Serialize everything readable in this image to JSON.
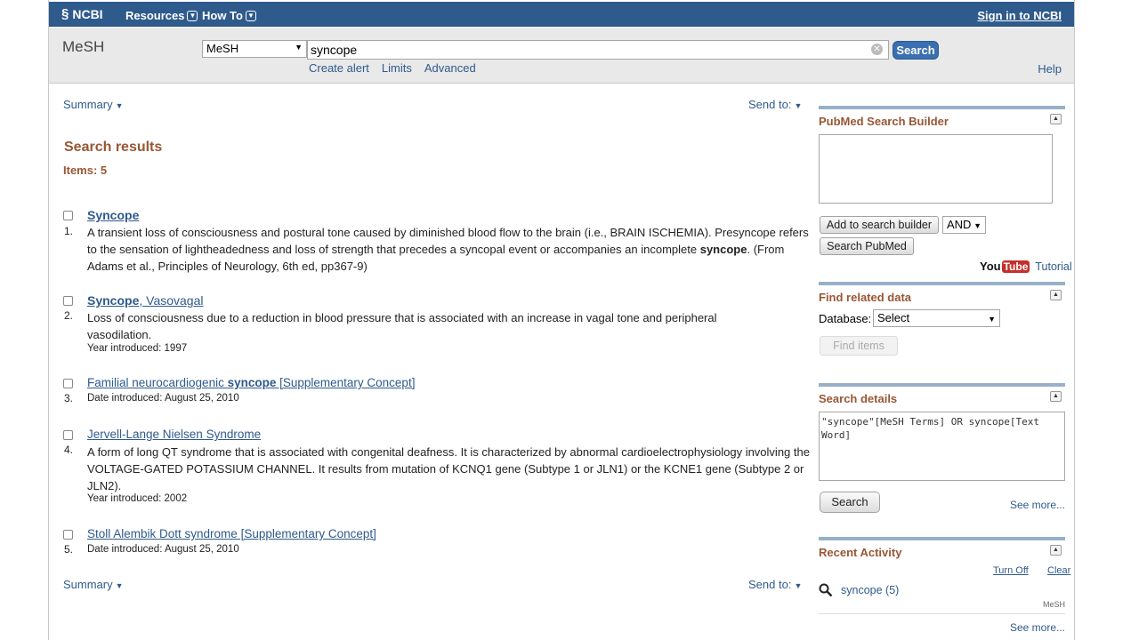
{
  "topbar": {
    "logo": "NCBI",
    "resources": "Resources",
    "howto": "How To",
    "signin": "Sign in to NCBI"
  },
  "search": {
    "db_name": "MeSH",
    "db_selected": "MeSH",
    "query": "syncope",
    "button": "Search",
    "links": [
      "Create alert",
      "Limits",
      "Advanced"
    ],
    "help": "Help"
  },
  "results": {
    "summary_label": "Summary",
    "sendto_label": "Send to:",
    "title": "Search results",
    "items_label": "Items: 5",
    "list": [
      {
        "num": "1.",
        "title_pre": "",
        "title_bold": "Syncope",
        "title_post": "",
        "desc_pre": "A transient loss of consciousness and postural tone caused by diminished blood flow to the brain (i.e., BRAIN ISCHEMIA). Presyncope refers to the sensation of lightheadedness and loss of strength that precedes a syncopal event or accompanies an incomplete ",
        "desc_bold": "syncope",
        "desc_post": ". (From Adams et al., Principles of Neurology, 6th ed, pp367-9)",
        "meta": ""
      },
      {
        "num": "2.",
        "title_pre": "",
        "title_bold": "Syncope",
        "title_post": ", Vasovagal",
        "desc_pre": "Loss of consciousness due to a reduction in blood pressure that is associated with an increase in vagal tone and peripheral vasodilation.",
        "desc_bold": "",
        "desc_post": "",
        "meta": "Year introduced: 1997"
      },
      {
        "num": "3.",
        "title_pre": "Familial neurocardiogenic ",
        "title_bold": "syncope",
        "title_post": " [Supplementary Concept]",
        "desc_pre": "",
        "desc_bold": "",
        "desc_post": "",
        "meta": "Date introduced: August 25, 2010"
      },
      {
        "num": "4.",
        "title_pre": "Jervell-Lange Nielsen Syndrome",
        "title_bold": "",
        "title_post": "",
        "desc_pre": "A form of long QT syndrome that is associated with congenital deafness. It is characterized by abnormal cardioelectrophysiology involving the VOLTAGE-GATED POTASSIUM CHANNEL. It results from mutation of KCNQ1 gene (Subtype 1 or JLN1) or the KCNE1 gene (Subtype 2 or JLN2).",
        "desc_bold": "",
        "desc_post": "",
        "meta": "Year introduced: 2002"
      },
      {
        "num": "5.",
        "title_pre": "Stoll Alembik Dott syndrome [Supplementary Concept]",
        "title_bold": "",
        "title_post": "",
        "desc_pre": "",
        "desc_bold": "",
        "desc_post": "",
        "meta": "Date introduced: August 25, 2010"
      }
    ]
  },
  "sidebar": {
    "builder": {
      "title": "PubMed Search Builder",
      "add_button": "Add to search builder",
      "operator": "AND",
      "search_button": "Search PubMed",
      "youtube_you": "You",
      "youtube_tube": "Tube",
      "tutorial": "Tutorial"
    },
    "related": {
      "title": "Find related data",
      "db_label": "Database:",
      "db_selected": "Select",
      "find_button": "Find items"
    },
    "details": {
      "title": "Search details",
      "query_text": "\"syncope\"[MeSH Terms] OR syncope[Text Word]",
      "search_button": "Search",
      "see_more": "See more..."
    },
    "activity": {
      "title": "Recent Activity",
      "turn_off": "Turn Off",
      "clear": "Clear",
      "item_text": "syncope (5)",
      "item_db": "MeSH",
      "see_more": "See more..."
    }
  }
}
